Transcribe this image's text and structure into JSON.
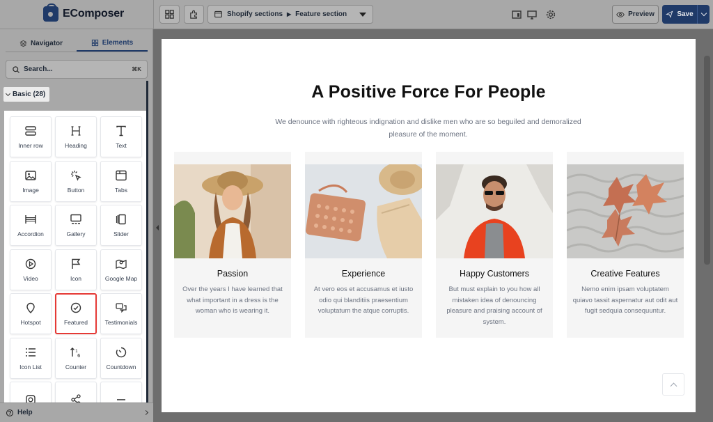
{
  "app": {
    "name": "EComposer"
  },
  "toolbar": {
    "section_path_1": "Shopify sections",
    "section_path_2": "Feature section",
    "preview_label": "Preview",
    "save_label": "Save"
  },
  "sidebar": {
    "tabs": [
      {
        "label": "Navigator",
        "icon": "layers-icon",
        "active": false
      },
      {
        "label": "Elements",
        "icon": "grid-icon",
        "active": true
      }
    ],
    "search": {
      "placeholder": "Search...",
      "shortcut": "⌘K"
    },
    "group": {
      "label": "Basic (28)"
    },
    "elements": [
      {
        "label": "Inner row",
        "icon": "inner-row-icon"
      },
      {
        "label": "Heading",
        "icon": "heading-icon"
      },
      {
        "label": "Text",
        "icon": "text-icon"
      },
      {
        "label": "Image",
        "icon": "image-icon"
      },
      {
        "label": "Button",
        "icon": "button-icon"
      },
      {
        "label": "Tabs",
        "icon": "tabs-icon"
      },
      {
        "label": "Accordion",
        "icon": "accordion-icon"
      },
      {
        "label": "Gallery",
        "icon": "gallery-icon"
      },
      {
        "label": "Slider",
        "icon": "slider-icon"
      },
      {
        "label": "Video",
        "icon": "video-icon"
      },
      {
        "label": "Icon",
        "icon": "flag-icon"
      },
      {
        "label": "Google Map",
        "icon": "map-icon"
      },
      {
        "label": "Hotspot",
        "icon": "hotspot-icon"
      },
      {
        "label": "Featured",
        "icon": "check-circle-icon",
        "selected": true
      },
      {
        "label": "Testimonials",
        "icon": "testimonials-icon"
      },
      {
        "label": "Icon List",
        "icon": "icon-list-icon"
      },
      {
        "label": "Counter",
        "icon": "counter-icon"
      },
      {
        "label": "Countdown",
        "icon": "countdown-icon"
      },
      {
        "label": "",
        "icon": "instagram-icon"
      },
      {
        "label": "",
        "icon": "share-icon"
      },
      {
        "label": "",
        "icon": "divider-icon"
      }
    ],
    "help_label": "Help"
  },
  "page": {
    "title": "A Positive Force For People",
    "subtitle": "We denounce with righteous indignation and dislike men who are so beguiled and demoralized pleasure of the moment.",
    "cards": [
      {
        "title": "Passion",
        "description": "Over the years I have learned that what important in a dress is the woman who is wearing it.",
        "image": "woman-in-hat-photo"
      },
      {
        "title": "Experience",
        "description": "At vero eos et accusamus et iusto odio qui blanditiis praesentium voluptatum the atque corruptis.",
        "image": "purse-and-hat-photo"
      },
      {
        "title": "Happy Customers",
        "description": "But must explain to you how all mistaken idea of denouncing pleasure and praising account of system.",
        "image": "man-in-sunglasses-photo"
      },
      {
        "title": "Creative Features",
        "description": "Nemo enim ipsam voluptatem quiavo tassit aspernatur aut odit aut fugit sedquia consequuntur.",
        "image": "leaves-on-sweater-photo"
      }
    ]
  },
  "colors": {
    "brand": "#1f3a68",
    "selected_outline": "#e53935"
  }
}
